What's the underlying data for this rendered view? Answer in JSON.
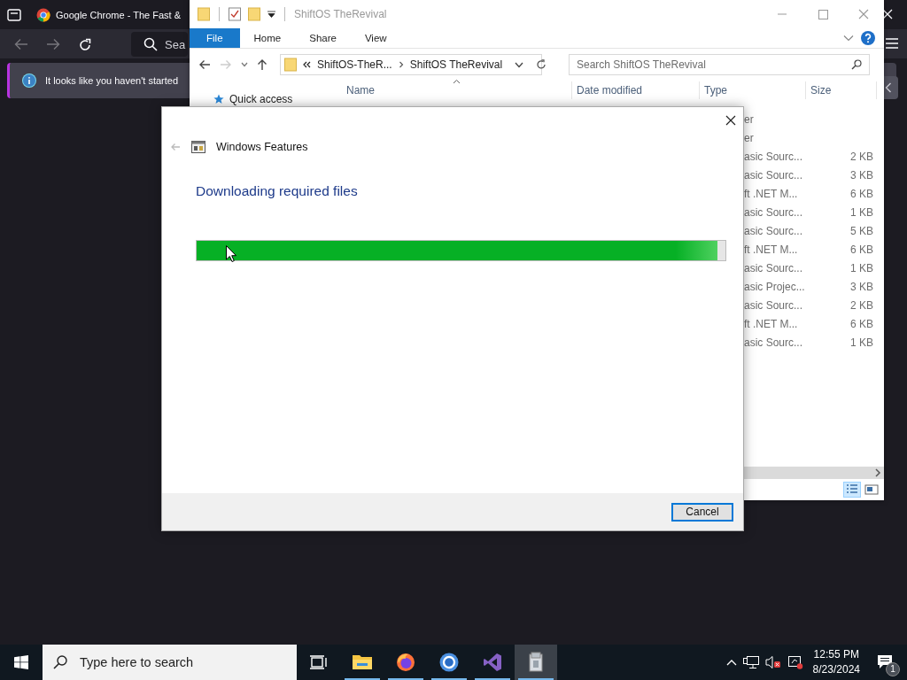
{
  "browser": {
    "tab_title": "Google Chrome - The Fast &",
    "search_placeholder": "Sea",
    "notice": "It looks like you haven't started"
  },
  "explorer": {
    "title": "ShiftOS TheRevival",
    "ribbon_tabs": [
      {
        "label": "File",
        "selected": true
      },
      {
        "label": "Home",
        "selected": false
      },
      {
        "label": "Share",
        "selected": false
      },
      {
        "label": "View",
        "selected": false
      }
    ],
    "breadcrumb": [
      "ShiftOS-TheR...",
      "ShiftOS TheRevival"
    ],
    "search_placeholder": "Search ShiftOS TheRevival",
    "columns": [
      "Name",
      "Date modified",
      "Type",
      "Size"
    ],
    "sidebar": [
      {
        "label": "Quick access"
      }
    ],
    "rows": [
      {
        "type": "er"
      },
      {
        "type": "er"
      },
      {
        "type": "asic Sourc...",
        "size": "2 KB"
      },
      {
        "type": "asic Sourc...",
        "size": "3 KB"
      },
      {
        "type": "ft .NET M...",
        "size": "6 KB"
      },
      {
        "type": "asic Sourc...",
        "size": "1 KB"
      },
      {
        "type": "asic Sourc...",
        "size": "5 KB"
      },
      {
        "type": "ft .NET M...",
        "size": "6 KB"
      },
      {
        "type": "asic Sourc...",
        "size": "1 KB"
      },
      {
        "type": "asic Projec...",
        "size": "3 KB"
      },
      {
        "type": "asic Sourc...",
        "size": "2 KB"
      },
      {
        "type": "ft .NET M...",
        "size": "6 KB"
      },
      {
        "type": "asic Sourc...",
        "size": "1 KB"
      }
    ]
  },
  "dialog": {
    "title": "Windows Features",
    "heading": "Downloading required files",
    "progress": {
      "level": 0.985
    },
    "buttons": [
      "Cancel"
    ]
  },
  "taskbar": {
    "search_placeholder": "Type here to search",
    "apps": [
      {
        "kind": "explorer",
        "running": true,
        "selected": false
      },
      {
        "kind": "firefox",
        "running": true,
        "selected": false
      },
      {
        "kind": "chrome",
        "running": true,
        "selected": false
      },
      {
        "kind": "visual-studio",
        "running": true,
        "selected": false
      },
      {
        "kind": "installer",
        "running": true,
        "selected": true
      }
    ],
    "time": "12:55 PM",
    "date": "8/23/2024",
    "notification_count": "1"
  }
}
